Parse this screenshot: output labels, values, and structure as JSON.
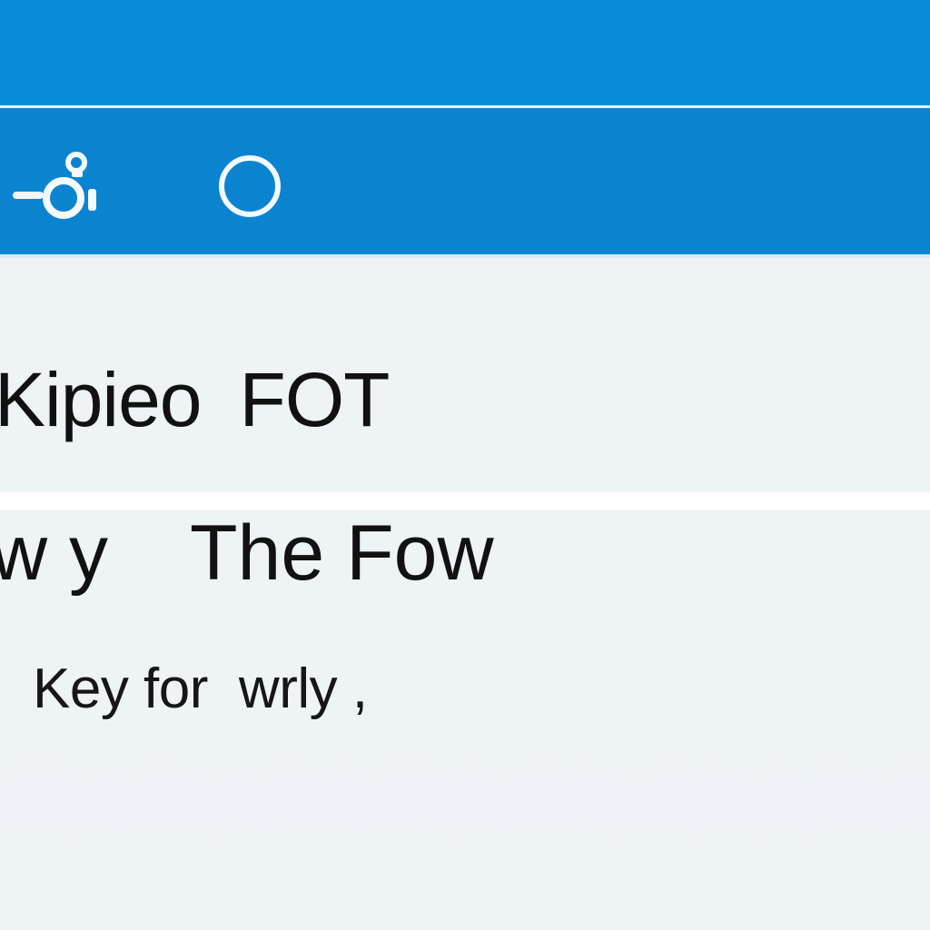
{
  "theme": {
    "accent": "#0a86d2",
    "accent_upper": "#088bd6",
    "divider": "#eaf3fb",
    "content_bg": "#eef3f6",
    "text": "#111111",
    "icon_color": "#f4f9ff"
  },
  "toolbar": {
    "icons": [
      {
        "name": "account-key-icon"
      },
      {
        "name": "circle-icon"
      }
    ]
  },
  "rows": [
    {
      "left": "Kipieo",
      "right": "FOT"
    },
    {
      "left": "w y",
      "right": "The Fow"
    },
    {
      "left": "Key for",
      "right": "wrly ,"
    }
  ]
}
